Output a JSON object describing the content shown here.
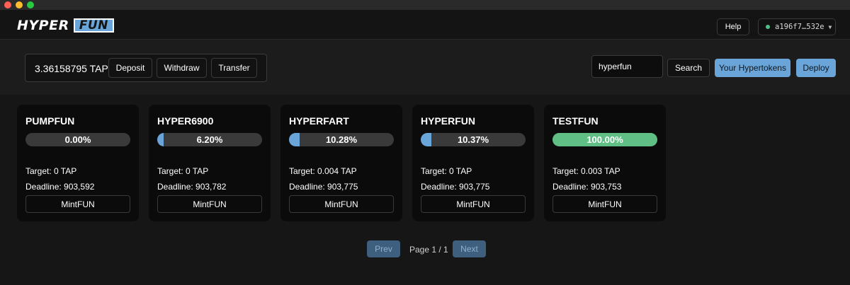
{
  "brand": {
    "logo_left": "HYPER",
    "logo_right": "FUN"
  },
  "header": {
    "help_label": "Help",
    "wallet_address": "a196f7…532e",
    "wallet_status_color": "#4fbf87"
  },
  "balance": {
    "amount": "3.36158795 TAP",
    "deposit_label": "Deposit",
    "withdraw_label": "Withdraw",
    "transfer_label": "Transfer"
  },
  "search": {
    "value": "hyperfun",
    "button_label": "Search"
  },
  "actions": {
    "your_hypertokens_label": "Your Hypertokens",
    "deploy_label": "Deploy"
  },
  "tokens": [
    {
      "name": "PUMPFUN",
      "progress": 0.0,
      "progress_label": "0.00%",
      "target": "Target: 0 TAP",
      "deadline": "Deadline: 903,592",
      "mint_label": "MintFUN"
    },
    {
      "name": "HYPER6900",
      "progress": 6.2,
      "progress_label": "6.20%",
      "target": "Target: 0 TAP",
      "deadline": "Deadline: 903,782",
      "mint_label": "MintFUN"
    },
    {
      "name": "HYPERFART",
      "progress": 10.28,
      "progress_label": "10.28%",
      "target": "Target: 0.004 TAP",
      "deadline": "Deadline: 903,775",
      "mint_label": "MintFUN"
    },
    {
      "name": "HYPERFUN",
      "progress": 10.37,
      "progress_label": "10.37%",
      "target": "Target: 0 TAP",
      "deadline": "Deadline: 903,775",
      "mint_label": "MintFUN"
    },
    {
      "name": "TESTFUN",
      "progress": 100.0,
      "progress_label": "100.00%",
      "target": "Target: 0.003 TAP",
      "deadline": "Deadline: 903,753",
      "mint_label": "MintFUN"
    }
  ],
  "pagination": {
    "prev_label": "Prev",
    "page_label": "Page 1 / 1",
    "next_label": "Next"
  },
  "colors": {
    "accent": "#6aa5d9",
    "complete": "#5fbf85",
    "background": "#1c1c1c",
    "card": "#0b0b0b"
  }
}
